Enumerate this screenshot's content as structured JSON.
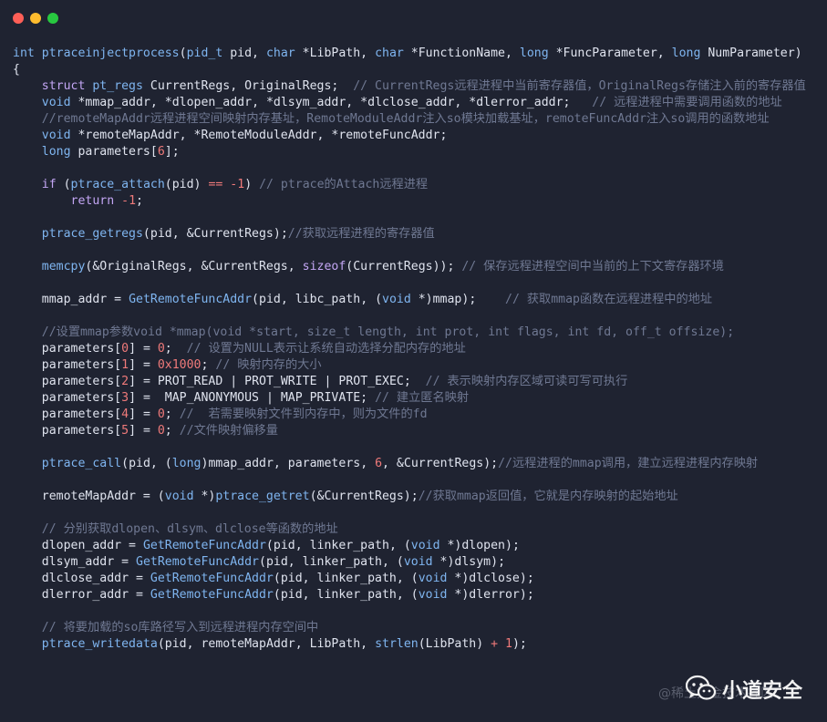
{
  "window": {
    "colors": {
      "background": "#1f2331",
      "close": "#fe5f57",
      "minimize": "#febc2e",
      "maximize": "#28c840"
    }
  },
  "code_lines": [
    [
      [
        "t",
        "int "
      ],
      [
        "f",
        "ptraceinjectprocess"
      ],
      [
        "p",
        "("
      ],
      [
        "t",
        "pid_t "
      ],
      [
        "v",
        "pid"
      ],
      [
        "p",
        ", "
      ],
      [
        "t",
        "char "
      ],
      [
        "p",
        "*"
      ],
      [
        "v",
        "LibPath"
      ],
      [
        "p",
        ", "
      ],
      [
        "t",
        "char "
      ],
      [
        "p",
        "*"
      ],
      [
        "v",
        "FunctionName"
      ],
      [
        "p",
        ", "
      ],
      [
        "t",
        "long "
      ],
      [
        "p",
        "*"
      ],
      [
        "v",
        "FuncParameter"
      ],
      [
        "p",
        ", "
      ],
      [
        "t",
        "long "
      ],
      [
        "v",
        "NumParameter"
      ],
      [
        "p",
        ")"
      ]
    ],
    [
      [
        "p",
        "{"
      ]
    ],
    [
      [
        "s",
        "    "
      ],
      [
        "k",
        "struct "
      ],
      [
        "t",
        "pt_regs "
      ],
      [
        "v",
        "CurrentRegs"
      ],
      [
        "p",
        ", "
      ],
      [
        "v",
        "OriginalRegs"
      ],
      [
        "p",
        ";  "
      ],
      [
        "c",
        "// CurrentRegs远程进程中当前寄存器值，OriginalRegs存储注入前的寄存器值"
      ]
    ],
    [
      [
        "s",
        "    "
      ],
      [
        "t",
        "void "
      ],
      [
        "p",
        "*"
      ],
      [
        "v",
        "mmap_addr"
      ],
      [
        "p",
        ", *"
      ],
      [
        "v",
        "dlopen_addr"
      ],
      [
        "p",
        ", *"
      ],
      [
        "v",
        "dlsym_addr"
      ],
      [
        "p",
        ", *"
      ],
      [
        "v",
        "dlclose_addr"
      ],
      [
        "p",
        ", *"
      ],
      [
        "v",
        "dlerror_addr"
      ],
      [
        "p",
        ";   "
      ],
      [
        "c",
        "// 远程进程中需要调用函数的地址"
      ]
    ],
    [
      [
        "s",
        "    "
      ],
      [
        "c",
        "//remoteMapAddr远程进程空间映射内存基址，RemoteModuleAddr注入so模块加载基址，remoteFuncAddr注入so调用的函数地址"
      ]
    ],
    [
      [
        "s",
        "    "
      ],
      [
        "t",
        "void "
      ],
      [
        "p",
        "*"
      ],
      [
        "v",
        "remoteMapAddr"
      ],
      [
        "p",
        ", *"
      ],
      [
        "v",
        "RemoteModuleAddr"
      ],
      [
        "p",
        ", *"
      ],
      [
        "v",
        "remoteFuncAddr"
      ],
      [
        "p",
        ";"
      ]
    ],
    [
      [
        "s",
        "    "
      ],
      [
        "t",
        "long "
      ],
      [
        "v",
        "parameters"
      ],
      [
        "p",
        "["
      ],
      [
        "n",
        "6"
      ],
      [
        "p",
        "];"
      ]
    ],
    [],
    [
      [
        "s",
        "    "
      ],
      [
        "k",
        "if "
      ],
      [
        "p",
        "("
      ],
      [
        "f",
        "ptrace_attach"
      ],
      [
        "p",
        "("
      ],
      [
        "v",
        "pid"
      ],
      [
        "p",
        ") "
      ],
      [
        "o",
        "=="
      ],
      [
        "p",
        " "
      ],
      [
        "o",
        "-"
      ],
      [
        "n",
        "1"
      ],
      [
        "p",
        ") "
      ],
      [
        "c",
        "// ptrace的Attach远程进程"
      ]
    ],
    [
      [
        "s",
        "        "
      ],
      [
        "k",
        "return "
      ],
      [
        "o",
        "-"
      ],
      [
        "n",
        "1"
      ],
      [
        "p",
        ";"
      ]
    ],
    [],
    [
      [
        "s",
        "    "
      ],
      [
        "f",
        "ptrace_getregs"
      ],
      [
        "p",
        "("
      ],
      [
        "v",
        "pid"
      ],
      [
        "p",
        ", &"
      ],
      [
        "v",
        "CurrentRegs"
      ],
      [
        "p",
        ");"
      ],
      [
        "c",
        "//获取远程进程的寄存器值"
      ]
    ],
    [],
    [
      [
        "s",
        "    "
      ],
      [
        "f",
        "memcpy"
      ],
      [
        "p",
        "(&"
      ],
      [
        "v",
        "OriginalRegs"
      ],
      [
        "p",
        ", &"
      ],
      [
        "v",
        "CurrentRegs"
      ],
      [
        "p",
        ", "
      ],
      [
        "k",
        "sizeof"
      ],
      [
        "p",
        "("
      ],
      [
        "v",
        "CurrentRegs"
      ],
      [
        "p",
        "));"
      ],
      [
        "p",
        " "
      ],
      [
        "c",
        "// 保存远程进程空间中当前的上下文寄存器环境"
      ]
    ],
    [],
    [
      [
        "s",
        "    "
      ],
      [
        "v",
        "mmap_addr"
      ],
      [
        "p",
        " = "
      ],
      [
        "f",
        "GetRemoteFuncAddr"
      ],
      [
        "p",
        "("
      ],
      [
        "v",
        "pid"
      ],
      [
        "p",
        ", "
      ],
      [
        "v",
        "libc_path"
      ],
      [
        "p",
        ", ("
      ],
      [
        "t",
        "void "
      ],
      [
        "p",
        "*)"
      ],
      [
        "v",
        "mmap"
      ],
      [
        "p",
        ");    "
      ],
      [
        "c",
        "// 获取mmap函数在远程进程中的地址"
      ]
    ],
    [],
    [
      [
        "s",
        "    "
      ],
      [
        "c",
        "//设置mmap参数void *mmap(void *start, size_t length, int prot, int flags, int fd, off_t offsize);"
      ]
    ],
    [
      [
        "s",
        "    "
      ],
      [
        "v",
        "parameters"
      ],
      [
        "p",
        "["
      ],
      [
        "n",
        "0"
      ],
      [
        "p",
        "] = "
      ],
      [
        "n",
        "0"
      ],
      [
        "p",
        ";  "
      ],
      [
        "c",
        "// 设置为NULL表示让系统自动选择分配内存的地址"
      ]
    ],
    [
      [
        "s",
        "    "
      ],
      [
        "v",
        "parameters"
      ],
      [
        "p",
        "["
      ],
      [
        "n",
        "1"
      ],
      [
        "p",
        "] = "
      ],
      [
        "n",
        "0x1000"
      ],
      [
        "p",
        "; "
      ],
      [
        "c",
        "// 映射内存的大小"
      ]
    ],
    [
      [
        "s",
        "    "
      ],
      [
        "v",
        "parameters"
      ],
      [
        "p",
        "["
      ],
      [
        "n",
        "2"
      ],
      [
        "p",
        "] = "
      ],
      [
        "v",
        "PROT_READ"
      ],
      [
        "p",
        " | "
      ],
      [
        "v",
        "PROT_WRITE"
      ],
      [
        "p",
        " | "
      ],
      [
        "v",
        "PROT_EXEC"
      ],
      [
        "p",
        ";  "
      ],
      [
        "c",
        "// 表示映射内存区域可读可写可执行"
      ]
    ],
    [
      [
        "s",
        "    "
      ],
      [
        "v",
        "parameters"
      ],
      [
        "p",
        "["
      ],
      [
        "n",
        "3"
      ],
      [
        "p",
        "] =  "
      ],
      [
        "v",
        "MAP_ANONYMOUS"
      ],
      [
        "p",
        " | "
      ],
      [
        "v",
        "MAP_PRIVATE"
      ],
      [
        "p",
        "; "
      ],
      [
        "c",
        "// 建立匿名映射"
      ]
    ],
    [
      [
        "s",
        "    "
      ],
      [
        "v",
        "parameters"
      ],
      [
        "p",
        "["
      ],
      [
        "n",
        "4"
      ],
      [
        "p",
        "] = "
      ],
      [
        "n",
        "0"
      ],
      [
        "p",
        "; "
      ],
      [
        "c",
        "//  若需要映射文件到内存中，则为文件的fd"
      ]
    ],
    [
      [
        "s",
        "    "
      ],
      [
        "v",
        "parameters"
      ],
      [
        "p",
        "["
      ],
      [
        "n",
        "5"
      ],
      [
        "p",
        "] = "
      ],
      [
        "n",
        "0"
      ],
      [
        "p",
        "; "
      ],
      [
        "c",
        "//文件映射偏移量"
      ]
    ],
    [],
    [
      [
        "s",
        "    "
      ],
      [
        "f",
        "ptrace_call"
      ],
      [
        "p",
        "("
      ],
      [
        "v",
        "pid"
      ],
      [
        "p",
        ", ("
      ],
      [
        "t",
        "long"
      ],
      [
        "p",
        ")"
      ],
      [
        "v",
        "mmap_addr"
      ],
      [
        "p",
        ", "
      ],
      [
        "v",
        "parameters"
      ],
      [
        "p",
        ", "
      ],
      [
        "n",
        "6"
      ],
      [
        "p",
        ", &"
      ],
      [
        "v",
        "CurrentRegs"
      ],
      [
        "p",
        ");"
      ],
      [
        "c",
        "//远程进程的mmap调用，建立远程进程内存映射"
      ]
    ],
    [],
    [
      [
        "s",
        "    "
      ],
      [
        "v",
        "remoteMapAddr"
      ],
      [
        "p",
        " = ("
      ],
      [
        "t",
        "void "
      ],
      [
        "p",
        "*)"
      ],
      [
        "f",
        "ptrace_getret"
      ],
      [
        "p",
        "(&"
      ],
      [
        "v",
        "CurrentRegs"
      ],
      [
        "p",
        ");"
      ],
      [
        "c",
        "//获取mmap返回值，它就是内存映射的起始地址"
      ]
    ],
    [],
    [
      [
        "s",
        "    "
      ],
      [
        "c",
        "// 分别获取dlopen、dlsym、dlclose等函数的地址"
      ]
    ],
    [
      [
        "s",
        "    "
      ],
      [
        "v",
        "dlopen_addr"
      ],
      [
        "p",
        " = "
      ],
      [
        "f",
        "GetRemoteFuncAddr"
      ],
      [
        "p",
        "("
      ],
      [
        "v",
        "pid"
      ],
      [
        "p",
        ", "
      ],
      [
        "v",
        "linker_path"
      ],
      [
        "p",
        ", ("
      ],
      [
        "t",
        "void "
      ],
      [
        "p",
        "*)"
      ],
      [
        "v",
        "dlopen"
      ],
      [
        "p",
        ");"
      ]
    ],
    [
      [
        "s",
        "    "
      ],
      [
        "v",
        "dlsym_addr"
      ],
      [
        "p",
        " = "
      ],
      [
        "f",
        "GetRemoteFuncAddr"
      ],
      [
        "p",
        "("
      ],
      [
        "v",
        "pid"
      ],
      [
        "p",
        ", "
      ],
      [
        "v",
        "linker_path"
      ],
      [
        "p",
        ", ("
      ],
      [
        "t",
        "void "
      ],
      [
        "p",
        "*)"
      ],
      [
        "v",
        "dlsym"
      ],
      [
        "p",
        ");"
      ]
    ],
    [
      [
        "s",
        "    "
      ],
      [
        "v",
        "dlclose_addr"
      ],
      [
        "p",
        " = "
      ],
      [
        "f",
        "GetRemoteFuncAddr"
      ],
      [
        "p",
        "("
      ],
      [
        "v",
        "pid"
      ],
      [
        "p",
        ", "
      ],
      [
        "v",
        "linker_path"
      ],
      [
        "p",
        ", ("
      ],
      [
        "t",
        "void "
      ],
      [
        "p",
        "*)"
      ],
      [
        "v",
        "dlclose"
      ],
      [
        "p",
        ");"
      ]
    ],
    [
      [
        "s",
        "    "
      ],
      [
        "v",
        "dlerror_addr"
      ],
      [
        "p",
        " = "
      ],
      [
        "f",
        "GetRemoteFuncAddr"
      ],
      [
        "p",
        "("
      ],
      [
        "v",
        "pid"
      ],
      [
        "p",
        ", "
      ],
      [
        "v",
        "linker_path"
      ],
      [
        "p",
        ", ("
      ],
      [
        "t",
        "void "
      ],
      [
        "p",
        "*)"
      ],
      [
        "v",
        "dlerror"
      ],
      [
        "p",
        ");"
      ]
    ],
    [],
    [
      [
        "s",
        "    "
      ],
      [
        "c",
        "// 将要加载的so库路径写入到远程进程内存空间中"
      ]
    ],
    [
      [
        "s",
        "    "
      ],
      [
        "f",
        "ptrace_writedata"
      ],
      [
        "p",
        "("
      ],
      [
        "v",
        "pid"
      ],
      [
        "p",
        ", "
      ],
      [
        "v",
        "remoteMapAddr"
      ],
      [
        "p",
        ", "
      ],
      [
        "v",
        "LibPath"
      ],
      [
        "p",
        ", "
      ],
      [
        "f",
        "strlen"
      ],
      [
        "p",
        "("
      ],
      [
        "v",
        "LibPath"
      ],
      [
        "p",
        ") "
      ],
      [
        "o",
        "+"
      ],
      [
        "p",
        " "
      ],
      [
        "n",
        "1"
      ],
      [
        "p",
        ");"
      ]
    ]
  ],
  "watermark": {
    "shadow_text": "@稀土掘金技术社区",
    "name": "小道安全",
    "icon": "wechat-icon"
  }
}
